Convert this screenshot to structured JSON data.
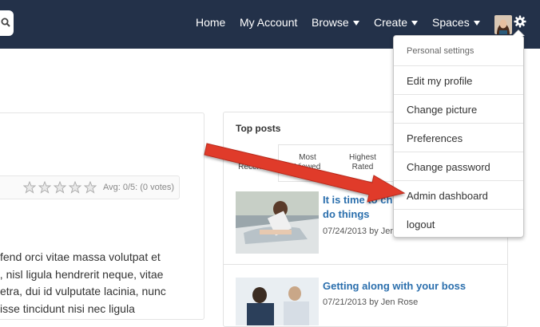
{
  "nav": {
    "items": [
      {
        "label": "Home",
        "dropdown": false
      },
      {
        "label": "My Account",
        "dropdown": false
      },
      {
        "label": "Browse",
        "dropdown": true
      },
      {
        "label": "Create",
        "dropdown": true
      },
      {
        "label": "Spaces",
        "dropdown": true
      }
    ],
    "icons": [
      "search-icon",
      "avatar",
      "gear-icon"
    ],
    "colors": {
      "bar": "#233149",
      "text": "#ffffff"
    }
  },
  "rating": {
    "stars": 5,
    "filled": 0,
    "avg_text": "Avg: 0/5: (0 votes)"
  },
  "article": {
    "lines": [
      "fend orci vitae massa volutpat et",
      "n, nisl ligula hendrerit neque, vitae",
      "etra, dui id vulputate lacinia, nunc",
      "isse tincidunt nisi nec ligula"
    ]
  },
  "top_posts": {
    "title": "Top posts",
    "tabs": [
      {
        "label": "Recent",
        "active": true
      },
      {
        "label": "Most Viewed",
        "active": false
      },
      {
        "label": "Highest Rated",
        "active": false
      }
    ],
    "posts": [
      {
        "title": "It is time to ch do things",
        "meta": "07/24/2013 by Jen"
      },
      {
        "title": "Getting along with your boss",
        "meta": "07/21/2013 by Jen Rose"
      }
    ],
    "link_color": "#2b6fad"
  },
  "dropdown": {
    "header": "Personal settings",
    "items": [
      {
        "label": "Edit my profile"
      },
      {
        "label": "Change picture"
      },
      {
        "label": "Preferences"
      },
      {
        "label": "Change password"
      },
      {
        "label": "Admin dashboard"
      },
      {
        "label": "logout"
      }
    ]
  },
  "annotation": {
    "color": "#e03a2a",
    "points_to": "Admin dashboard"
  }
}
